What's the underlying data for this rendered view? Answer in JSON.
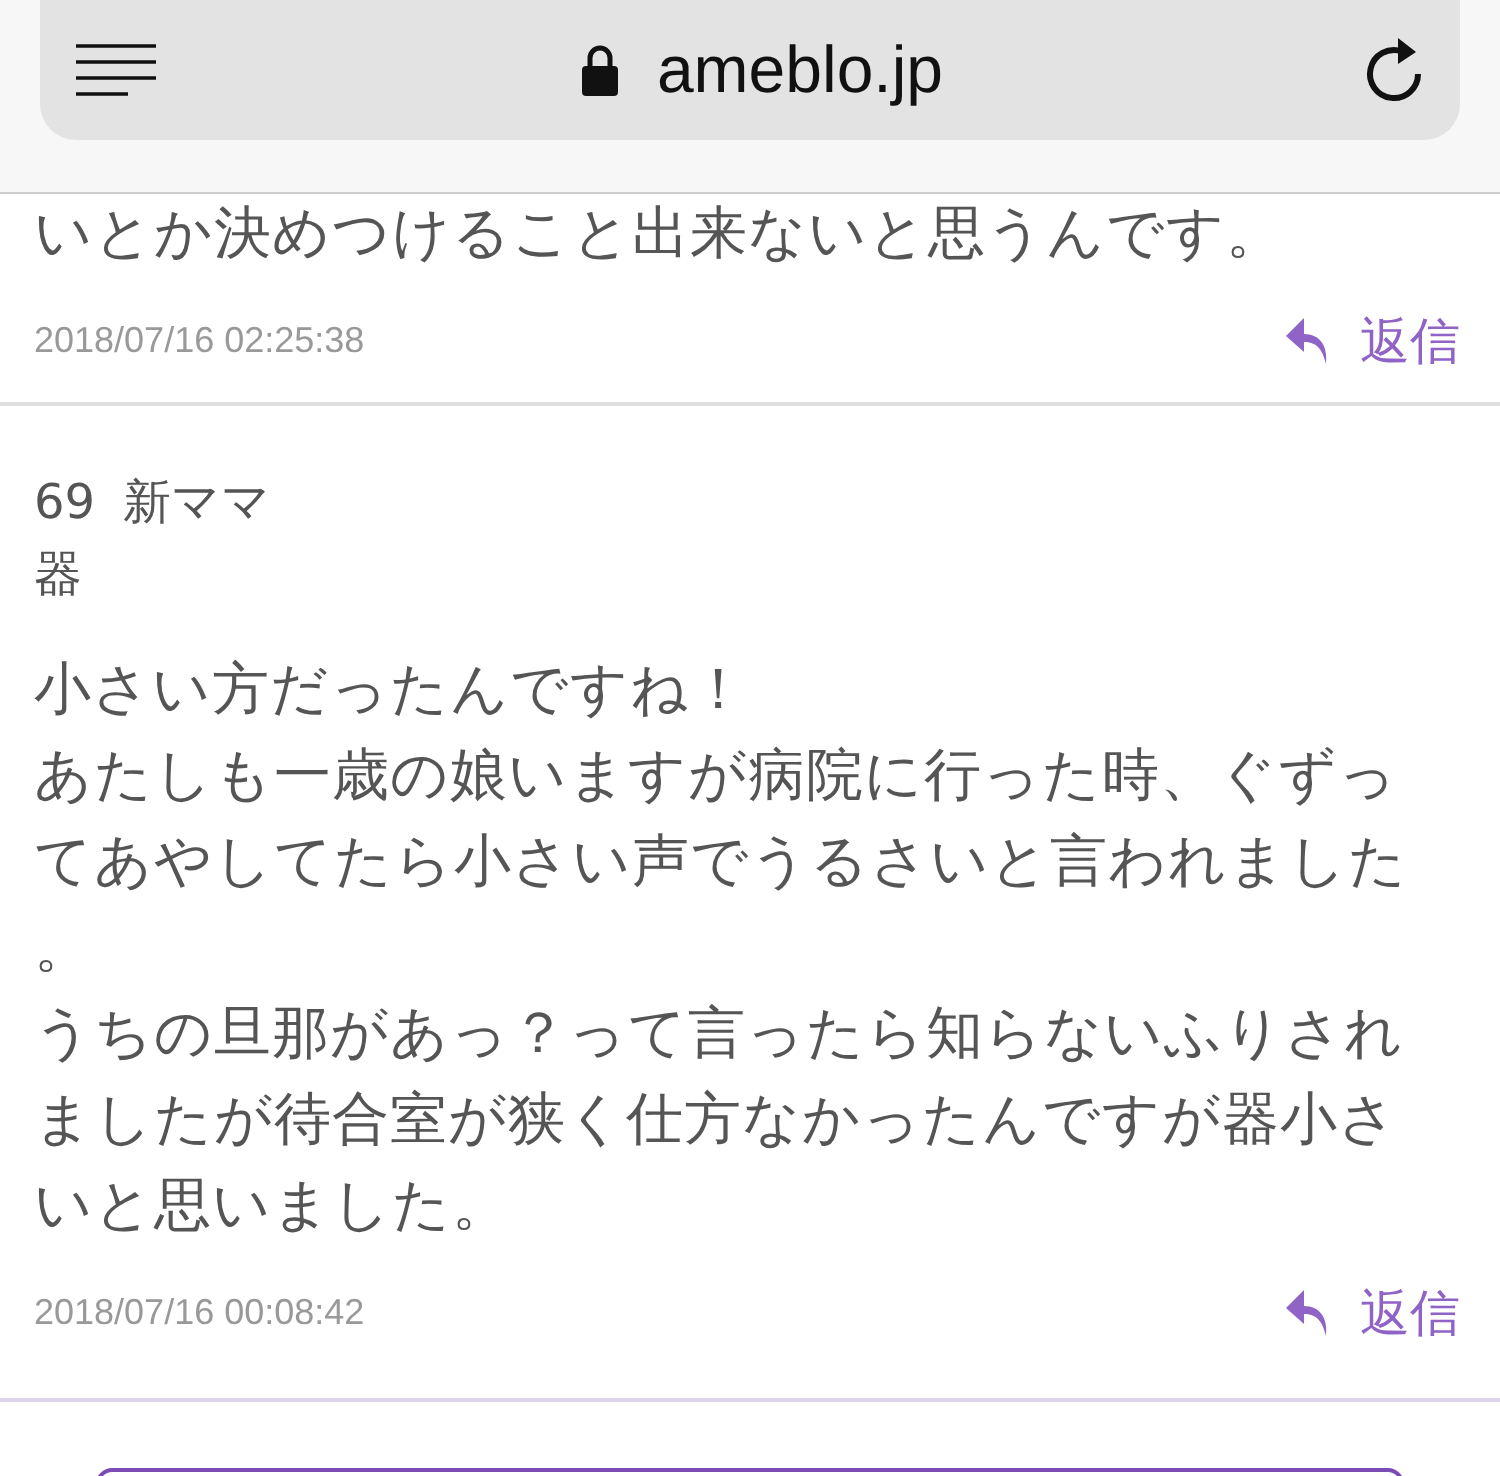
{
  "browser_bar": {
    "url": "ameblo.jp"
  },
  "comments": [
    {
      "lines": [
        "いとか決めつけること出来ないと思うんです。"
      ],
      "date": "2018/07/16 02:25:38",
      "reply": "返信"
    },
    {
      "number": "69",
      "name": [
        "新ママ",
        "器"
      ],
      "lines": [
        "小さい方だったんですね！",
        "あたしも一歳の娘いますが病院に行った時、ぐずっ",
        "てあやしてたら小さい声でうるさいと言われました",
        "。",
        "うちの旦那があっ？って言ったら知らないふりされ",
        "ましたが待合室が狭く仕方なかったんですが器小さ",
        "いと思いました。"
      ],
      "date": "2018/07/16 00:08:42",
      "reply": "返信"
    }
  ]
}
